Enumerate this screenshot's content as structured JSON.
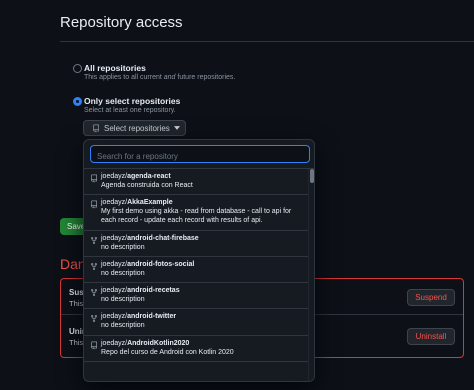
{
  "section": {
    "title": "Repository access"
  },
  "options": {
    "all": {
      "label": "All repositories",
      "desc_prefix": "This applies to all current ",
      "desc_em": "and",
      "desc_suffix": " future repositories."
    },
    "select": {
      "label": "Only select repositories",
      "desc": "Select at least one repository."
    }
  },
  "select_button": {
    "label": "Select repositories"
  },
  "save_button": {
    "label": "Save"
  },
  "danger": {
    "title": "Danger zone",
    "rows": [
      {
        "label": "Suspend",
        "desc": "This",
        "button": "Suspend"
      },
      {
        "label": "Uninstall",
        "desc": "This",
        "button": "Uninstall"
      }
    ]
  },
  "popover": {
    "search_placeholder": "Search for a repository",
    "repos": [
      {
        "owner": "joedayz/",
        "name": "agenda-react",
        "desc": "Agenda construida con React",
        "icon": "repo-icon"
      },
      {
        "owner": "joedayz/",
        "name": "AkkaExample",
        "desc": "My first demo using akka - read from database - call to api for each record - update each record with results of api.",
        "icon": "repo-icon"
      },
      {
        "owner": "joedayz/",
        "name": "android-chat-firebase",
        "desc": "no description",
        "icon": "repo-forked-icon"
      },
      {
        "owner": "joedayz/",
        "name": "android-fotos-social",
        "desc": "no description",
        "icon": "repo-forked-icon"
      },
      {
        "owner": "joedayz/",
        "name": "android-recetas",
        "desc": "no description",
        "icon": "repo-forked-icon"
      },
      {
        "owner": "joedayz/",
        "name": "android-twitter",
        "desc": "no description",
        "icon": "repo-forked-icon"
      },
      {
        "owner": "joedayz/",
        "name": "AndroidKotlin2020",
        "desc": "Repo del curso de Android con Kotlin 2020",
        "icon": "repo-icon"
      }
    ]
  },
  "colors": {
    "background": "#0d1117",
    "accent": "#2f81f7",
    "danger": "#f85149",
    "primary_button": "#238636"
  }
}
